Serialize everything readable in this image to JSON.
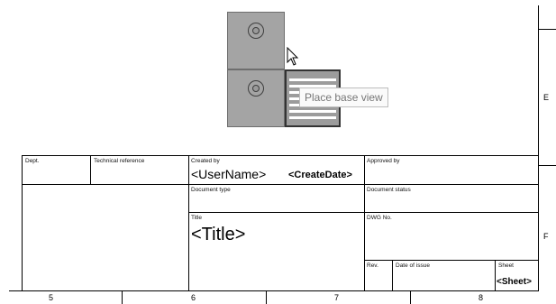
{
  "tooltip": {
    "text": "Place base view"
  },
  "title_block": {
    "dept_label": "Dept.",
    "tech_ref_label": "Technical reference",
    "created_by_label": "Created by",
    "created_by_value": "<UserName>",
    "create_date_value": "<CreateDate>",
    "approved_by_label": "Approved by",
    "document_type_label": "Document type",
    "document_status_label": "Document status",
    "title_label": "Title",
    "title_value": "<Title>",
    "dwg_no_label": "DWG No.",
    "rev_label": "Rev.",
    "date_of_issue_label": "Date of issue",
    "sheet_label": "Sheet",
    "sheet_value": "<Sheet>"
  },
  "zones": {
    "columns": [
      "5",
      "6",
      "7",
      "8"
    ],
    "rows": [
      "E",
      "F"
    ]
  },
  "icons": {
    "cursor": "mouse-pointer-icon",
    "view_cube": "view-cube-icon",
    "hole": "circle-hole-icon",
    "base_view": "base-view-icon"
  }
}
